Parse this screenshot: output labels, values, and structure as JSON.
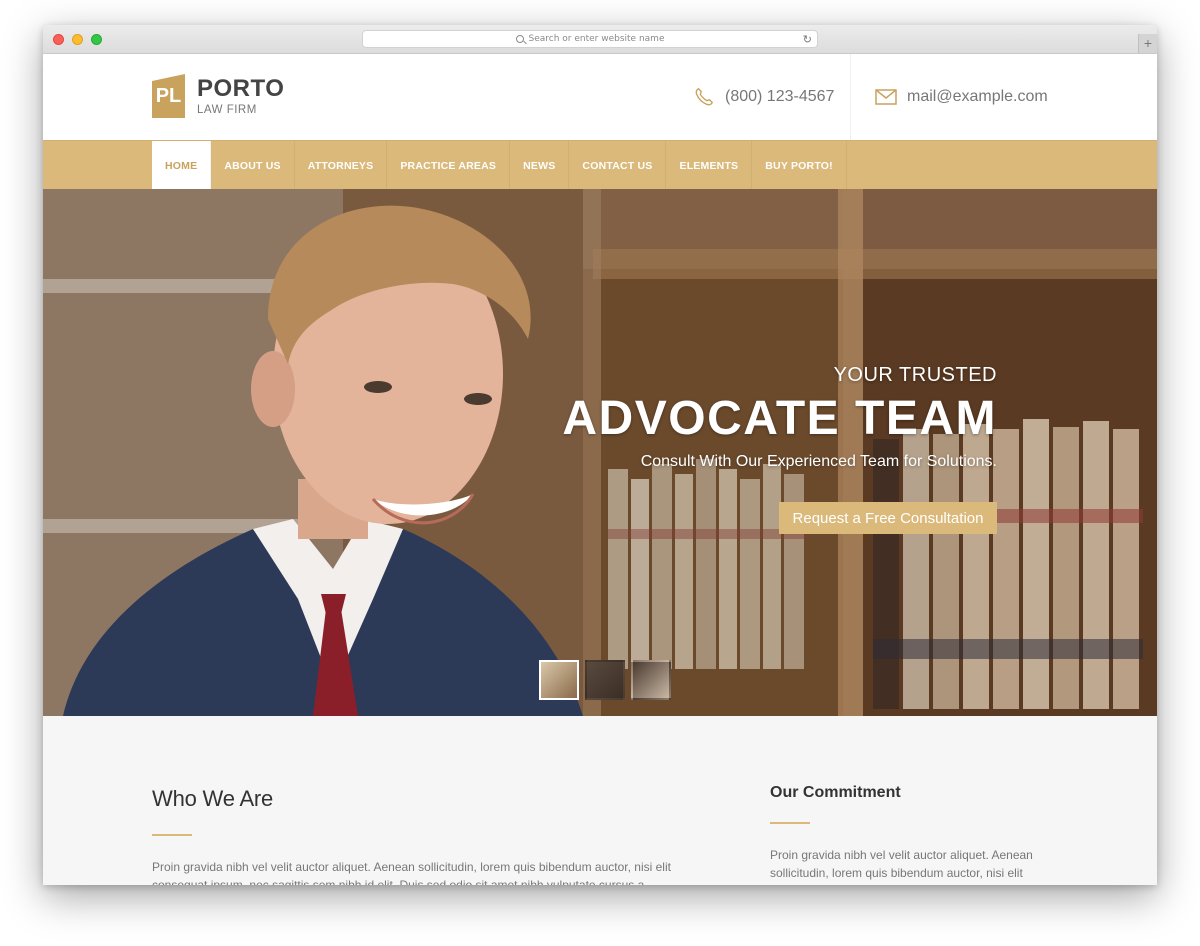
{
  "browser": {
    "address_placeholder": "Search or enter website name",
    "newtab_label": "+"
  },
  "header": {
    "logo_mark": "PL",
    "logo_name": "PORTO",
    "logo_sub": "LAW FIRM",
    "phone": "(800) 123-4567",
    "email": "mail@example.com"
  },
  "nav": {
    "items": [
      {
        "label": "HOME",
        "active": true
      },
      {
        "label": "ABOUT US"
      },
      {
        "label": "ATTORNEYS"
      },
      {
        "label": "PRACTICE AREAS"
      },
      {
        "label": "NEWS"
      },
      {
        "label": "CONTACT US"
      },
      {
        "label": "ELEMENTS"
      },
      {
        "label": "BUY PORTO!"
      }
    ]
  },
  "hero": {
    "pre": "YOUR TRUSTED",
    "title": "ADVOCATE TEAM",
    "sub": "Consult With Our Experienced Team for Solutions.",
    "cta": "Request a Free Consultation",
    "slide_count": 3,
    "active_slide": 1
  },
  "content": {
    "left": {
      "title": "Who We Are",
      "text": "Proin gravida nibh vel velit auctor aliquet. Aenean sollicitudin, lorem quis bibendum auctor, nisi elit consequat ipsum, nec sagittis sem nibh id elit. Duis sed odio sit amet nibh vulputate cursus a"
    },
    "right": {
      "title": "Our Commitment",
      "text": "Proin gravida nibh vel velit auctor aliquet. Aenean sollicitudin, lorem quis bibendum auctor, nisi elit"
    }
  },
  "colors": {
    "accent": "#dbb97a",
    "accent_dark": "#c9a25d"
  }
}
